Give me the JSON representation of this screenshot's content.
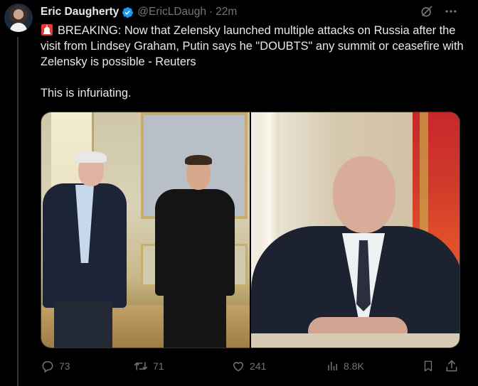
{
  "tweet": {
    "author_name": "Eric Daugherty",
    "handle": "@EricLDaugh",
    "separator": "·",
    "time": "22m",
    "body_line1": "BREAKING: Now that Zelensky launched multiple attacks on Russia after the visit from Lindsey Graham, Putin says he \"DOUBTS\" any summit or ceasefire with Zelensky is possible - Reuters",
    "body_line2": "This is infuriating."
  },
  "actions": {
    "replies": "73",
    "reposts": "71",
    "likes": "241",
    "views": "8.8K"
  },
  "icons": {
    "verified": "verified-badge-icon",
    "siren": "siren-emoji-icon",
    "grok": "grok-icon",
    "more": "more-icon",
    "reply": "reply-icon",
    "repost": "repost-icon",
    "like": "heart-icon",
    "views": "views-icon",
    "bookmark": "bookmark-icon",
    "share": "share-icon"
  },
  "colors": {
    "background": "#000000",
    "text_primary": "#e7e9ea",
    "text_secondary": "#71767b",
    "verified": "#1d9bf0"
  }
}
